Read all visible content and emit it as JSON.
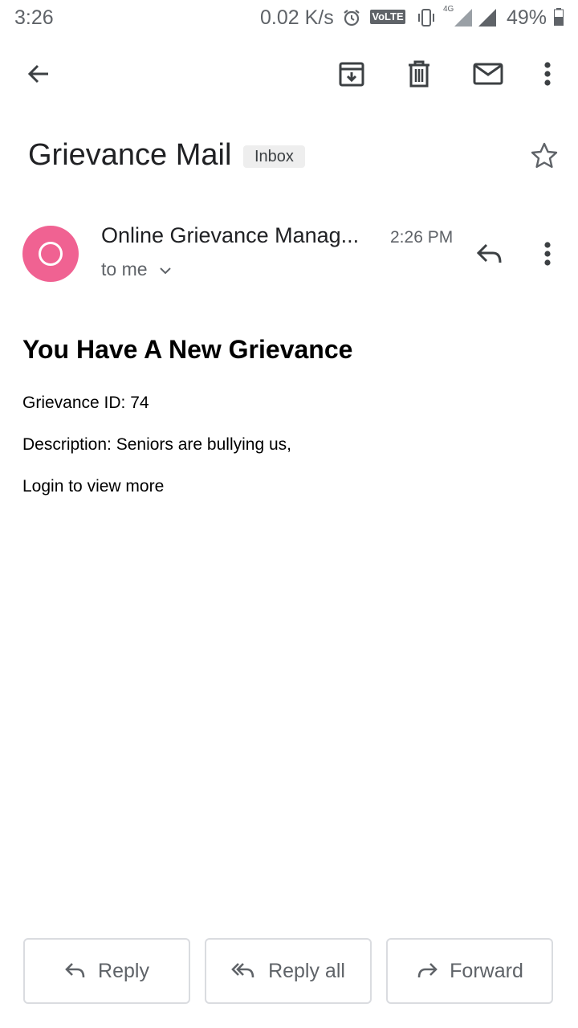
{
  "status_bar": {
    "time": "3:26",
    "net_speed": "0.02 K/s",
    "volte": "VoLTE",
    "network": "4G",
    "battery": "49%"
  },
  "toolbar": {
    "icons": [
      "back-arrow-icon",
      "archive-icon",
      "delete-icon",
      "mark-unread-icon",
      "more-vert-icon"
    ]
  },
  "email": {
    "subject": "Grievance Mail",
    "label": "Inbox",
    "sender": "Online Grievance Manag...",
    "time": "2:26 PM",
    "recipient": "to me",
    "avatar_color": "#f06292",
    "heading": "You Have A New Grievance",
    "lines": [
      "Grievance ID: 74",
      "Description: Seniors are bullying us,",
      "Login to view more"
    ]
  },
  "actions": {
    "reply": "Reply",
    "reply_all": "Reply all",
    "forward": "Forward"
  }
}
